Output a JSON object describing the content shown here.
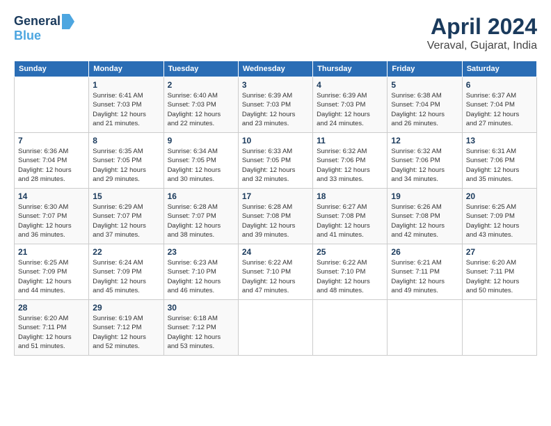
{
  "logo": {
    "line1": "General",
    "line2": "Blue"
  },
  "title": "April 2024",
  "location": "Veraval, Gujarat, India",
  "columns": [
    "Sunday",
    "Monday",
    "Tuesday",
    "Wednesday",
    "Thursday",
    "Friday",
    "Saturday"
  ],
  "weeks": [
    [
      {
        "day": "",
        "info": ""
      },
      {
        "day": "1",
        "info": "Sunrise: 6:41 AM\nSunset: 7:03 PM\nDaylight: 12 hours\nand 21 minutes."
      },
      {
        "day": "2",
        "info": "Sunrise: 6:40 AM\nSunset: 7:03 PM\nDaylight: 12 hours\nand 22 minutes."
      },
      {
        "day": "3",
        "info": "Sunrise: 6:39 AM\nSunset: 7:03 PM\nDaylight: 12 hours\nand 23 minutes."
      },
      {
        "day": "4",
        "info": "Sunrise: 6:39 AM\nSunset: 7:03 PM\nDaylight: 12 hours\nand 24 minutes."
      },
      {
        "day": "5",
        "info": "Sunrise: 6:38 AM\nSunset: 7:04 PM\nDaylight: 12 hours\nand 26 minutes."
      },
      {
        "day": "6",
        "info": "Sunrise: 6:37 AM\nSunset: 7:04 PM\nDaylight: 12 hours\nand 27 minutes."
      }
    ],
    [
      {
        "day": "7",
        "info": "Sunrise: 6:36 AM\nSunset: 7:04 PM\nDaylight: 12 hours\nand 28 minutes."
      },
      {
        "day": "8",
        "info": "Sunrise: 6:35 AM\nSunset: 7:05 PM\nDaylight: 12 hours\nand 29 minutes."
      },
      {
        "day": "9",
        "info": "Sunrise: 6:34 AM\nSunset: 7:05 PM\nDaylight: 12 hours\nand 30 minutes."
      },
      {
        "day": "10",
        "info": "Sunrise: 6:33 AM\nSunset: 7:05 PM\nDaylight: 12 hours\nand 32 minutes."
      },
      {
        "day": "11",
        "info": "Sunrise: 6:32 AM\nSunset: 7:06 PM\nDaylight: 12 hours\nand 33 minutes."
      },
      {
        "day": "12",
        "info": "Sunrise: 6:32 AM\nSunset: 7:06 PM\nDaylight: 12 hours\nand 34 minutes."
      },
      {
        "day": "13",
        "info": "Sunrise: 6:31 AM\nSunset: 7:06 PM\nDaylight: 12 hours\nand 35 minutes."
      }
    ],
    [
      {
        "day": "14",
        "info": "Sunrise: 6:30 AM\nSunset: 7:07 PM\nDaylight: 12 hours\nand 36 minutes."
      },
      {
        "day": "15",
        "info": "Sunrise: 6:29 AM\nSunset: 7:07 PM\nDaylight: 12 hours\nand 37 minutes."
      },
      {
        "day": "16",
        "info": "Sunrise: 6:28 AM\nSunset: 7:07 PM\nDaylight: 12 hours\nand 38 minutes."
      },
      {
        "day": "17",
        "info": "Sunrise: 6:28 AM\nSunset: 7:08 PM\nDaylight: 12 hours\nand 39 minutes."
      },
      {
        "day": "18",
        "info": "Sunrise: 6:27 AM\nSunset: 7:08 PM\nDaylight: 12 hours\nand 41 minutes."
      },
      {
        "day": "19",
        "info": "Sunrise: 6:26 AM\nSunset: 7:08 PM\nDaylight: 12 hours\nand 42 minutes."
      },
      {
        "day": "20",
        "info": "Sunrise: 6:25 AM\nSunset: 7:09 PM\nDaylight: 12 hours\nand 43 minutes."
      }
    ],
    [
      {
        "day": "21",
        "info": "Sunrise: 6:25 AM\nSunset: 7:09 PM\nDaylight: 12 hours\nand 44 minutes."
      },
      {
        "day": "22",
        "info": "Sunrise: 6:24 AM\nSunset: 7:09 PM\nDaylight: 12 hours\nand 45 minutes."
      },
      {
        "day": "23",
        "info": "Sunrise: 6:23 AM\nSunset: 7:10 PM\nDaylight: 12 hours\nand 46 minutes."
      },
      {
        "day": "24",
        "info": "Sunrise: 6:22 AM\nSunset: 7:10 PM\nDaylight: 12 hours\nand 47 minutes."
      },
      {
        "day": "25",
        "info": "Sunrise: 6:22 AM\nSunset: 7:10 PM\nDaylight: 12 hours\nand 48 minutes."
      },
      {
        "day": "26",
        "info": "Sunrise: 6:21 AM\nSunset: 7:11 PM\nDaylight: 12 hours\nand 49 minutes."
      },
      {
        "day": "27",
        "info": "Sunrise: 6:20 AM\nSunset: 7:11 PM\nDaylight: 12 hours\nand 50 minutes."
      }
    ],
    [
      {
        "day": "28",
        "info": "Sunrise: 6:20 AM\nSunset: 7:11 PM\nDaylight: 12 hours\nand 51 minutes."
      },
      {
        "day": "29",
        "info": "Sunrise: 6:19 AM\nSunset: 7:12 PM\nDaylight: 12 hours\nand 52 minutes."
      },
      {
        "day": "30",
        "info": "Sunrise: 6:18 AM\nSunset: 7:12 PM\nDaylight: 12 hours\nand 53 minutes."
      },
      {
        "day": "",
        "info": ""
      },
      {
        "day": "",
        "info": ""
      },
      {
        "day": "",
        "info": ""
      },
      {
        "day": "",
        "info": ""
      }
    ]
  ]
}
